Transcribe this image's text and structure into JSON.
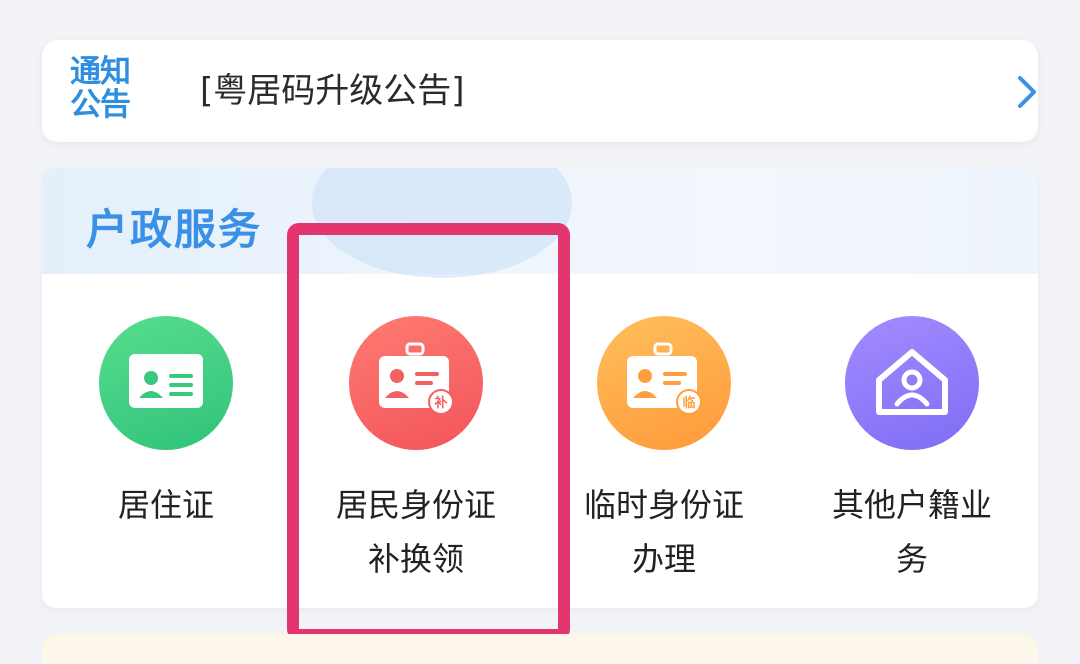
{
  "notice": {
    "tag_line1": "通知",
    "tag_line2": "公告",
    "text": "[粤居码升级公告]"
  },
  "section": {
    "title": "户政服务",
    "items": [
      {
        "label": "居住证",
        "icon": "residence-card-icon",
        "color": "#3dcf82"
      },
      {
        "label": "居民身份证补换领",
        "icon": "id-card-replace-icon",
        "color": "#f4605f",
        "badge": "补"
      },
      {
        "label": "临时身份证办理",
        "icon": "temporary-id-icon",
        "color": "#ffa843",
        "badge": "临"
      },
      {
        "label": "其他户籍业务",
        "icon": "household-house-icon",
        "color": "#8d79f8"
      }
    ]
  },
  "highlight_color": "#e3366f"
}
